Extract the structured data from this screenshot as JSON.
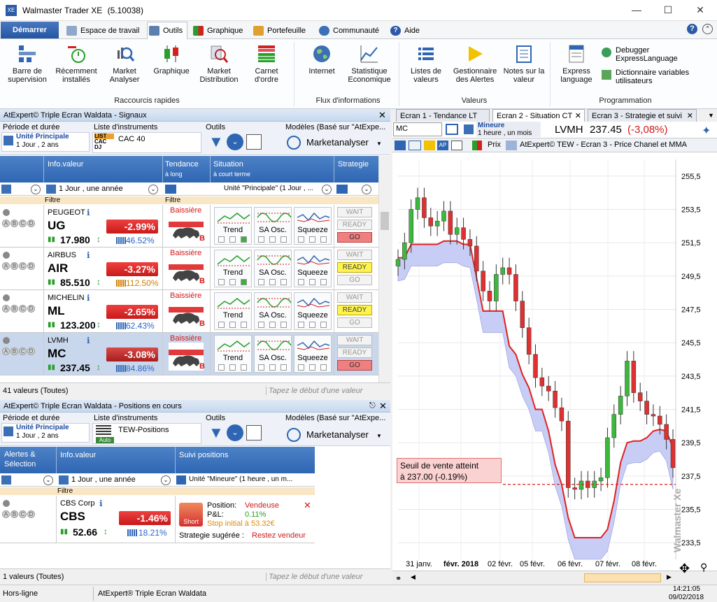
{
  "app": {
    "title": "Walmaster Trader XE",
    "version": "(5.10038)"
  },
  "menu": {
    "start": "Démarrer",
    "items": [
      "Espace de travail",
      "Outils",
      "Graphique",
      "Portefeuille",
      "Communauté",
      "Aide"
    ]
  },
  "ribbon": {
    "groups": [
      {
        "label": "Raccourcis rapides",
        "buttons": [
          "Barre de supervision",
          "Récemment installés",
          "Market Analyser",
          "Graphique",
          "Market Distribution",
          "Carnet d'ordre"
        ]
      },
      {
        "label": "Flux d'informations",
        "buttons": [
          "Internet",
          "Statistique Economique"
        ]
      },
      {
        "label": "Valeurs",
        "buttons": [
          "Listes de valeurs",
          "Gestionnaire des Alertes",
          "Notes sur la valeur"
        ]
      },
      {
        "label": "Programmation",
        "buttons": [
          "Express language"
        ],
        "small": [
          "Debugger ExpressLanguage",
          "Dictionnaire variables utilisateurs"
        ]
      }
    ],
    "b": {
      "b1a": "Barre de",
      "b1b": "supervision",
      "b2a": "Récemment",
      "b2b": "installés",
      "b3a": "Market",
      "b3b": "Analyser",
      "b4": "Graphique",
      "b5a": "Market",
      "b5b": "Distribution",
      "b6a": "Carnet",
      "b6b": "d'ordre",
      "b7": "Internet",
      "b8a": "Statistique",
      "b8b": "Economique",
      "b9a": "Listes de",
      "b9b": "valeurs",
      "b10a": "Gestionnaire",
      "b10b": "des Alertes",
      "b11a": "Notes sur la",
      "b11b": "valeur",
      "b12a": "Express",
      "b12b": "language",
      "s1a": "Debugger",
      "s1b": "ExpressLanguage",
      "s2a": "Dictionnaire variables",
      "s2b": "utilisateurs"
    }
  },
  "p1": {
    "title": "AtExpert© Triple Ecran Waldata - Signaux",
    "h_periode": "Période et durée",
    "unite": "Unité Principale",
    "duree": "1 Jour , 2 ans",
    "h_liste": "Liste d'instruments",
    "liste": "CAC 40",
    "lista": "LIST",
    "listb": "CAC",
    "listc": "DJ",
    "h_outils": "Outils",
    "h_modeles": "Modèles (Basé sur \"AtExpe...",
    "modele": "Marketanalyser",
    "c_info": "Info.valeur",
    "c_tend": "Tendance",
    "c_tend2": "à long",
    "c_sit": "Situation",
    "c_sit2": "à court terme",
    "c_strat": "Strategie",
    "f1": "1 Jour , une année",
    "f2": "Unité \"Principale\" (1 Jour , ...",
    "filtre": "Filtre",
    "footer": "41 valeurs (Toutes)",
    "search": "Tapez le début d'une valeur",
    "rows": [
      {
        "name": "PEUGEOT",
        "code": "UG",
        "price": "17.980",
        "pct": "-2.99%",
        "vol": "46.52%",
        "tend": "Baissière",
        "s1": "WAIT",
        "s2": "READY",
        "s3": "GO"
      },
      {
        "name": "AIRBUS",
        "code": "AIR",
        "price": "85.510",
        "pct": "-3.27%",
        "vol": "112.50%",
        "tend": "Baissière",
        "s1": "WAIT",
        "s2": "READY",
        "s3": "GO"
      },
      {
        "name": "MICHELIN",
        "code": "ML",
        "price": "123.200",
        "pct": "-2.65%",
        "vol": "62.43%",
        "tend": "Baissière",
        "s1": "WAIT",
        "s2": "READY",
        "s3": "GO"
      },
      {
        "name": "LVMH",
        "code": "MC",
        "price": "237.45",
        "pct": "-3.08%",
        "vol": "84.86%",
        "tend": "Baissière",
        "s1": "WAIT",
        "s2": "READY",
        "s3": "GO"
      }
    ],
    "ind": [
      "Trend",
      "SA Osc.",
      "Squeeze"
    ],
    "bmark": "B"
  },
  "p2": {
    "title": "AtExpert© Triple Ecran Waldata - Positions en cours",
    "h_periode": "Période et durée",
    "unite": "Unité Principale",
    "duree": "1 Jour , 2 ans",
    "h_liste": "Liste d'instruments",
    "liste": "TEW-Positions",
    "auto": "Auto",
    "h_outils": "Outils",
    "h_modeles": "Modèles (Basé sur \"AtExpe...",
    "modele": "Marketanalyser",
    "c_alert": "Alertes &",
    "c_alert2": "Sélection",
    "c_info": "Info.valeur",
    "c_suivi": "Suivi positions",
    "f1": "1 Jour , une année",
    "f2": "Unité \"Mineure\" (1 heure , un m...",
    "filtre": "Filtre",
    "row": {
      "name": "CBS Corp",
      "code": "CBS",
      "price": "52.66",
      "pct": "-1.46%",
      "vol": "18.21%",
      "pos_l": "Position:",
      "pos_v": "Vendeuse",
      "pnl_l": "P&L:",
      "pnl_v": "0.11%",
      "stop": "Stop initial à 53.32€",
      "strat_l": "Strategie sugérée :",
      "strat_v": "Restez vendeur",
      "short": "Short"
    },
    "footer": "1 valeurs (Toutes)",
    "search": "Tapez le début d'une valeur"
  },
  "chart_panel": {
    "tabs": [
      "Ecran 1 - Tendance LT",
      "Ecran 2 - Situation CT",
      "Ecran 3 - Strategie et suivi"
    ],
    "symbol_input": "MC",
    "unit": "Mineure",
    "unit2": "1 heure , un mois",
    "instrument": "LVMH",
    "last": "237.45",
    "change": "(-3,08%)",
    "toolbar_prix": "Prix",
    "chart_title": "AtExpert© TEW - Ecran 3 - Price Chanel et MMA",
    "alert_l1": "Seuil de vente atteint",
    "alert_l2": "à 237.00 (-0.19%)",
    "watermark": "Walmaster Xe"
  },
  "chart_data": {
    "type": "line",
    "title": "AtExpert© TEW - Ecran 3 - Price Chanel et MMA",
    "yticks": [
      "255,5",
      "253,5",
      "251,5",
      "249,5",
      "247,5",
      "245,5",
      "243,5",
      "241,5",
      "239,5",
      "237,5",
      "235,5",
      "233,5"
    ],
    "ylim": [
      232.5,
      256.5
    ],
    "xticks": [
      "31 janv.",
      "févr. 2018",
      "02 févr.",
      "05 févr.",
      "06 févr.",
      "07 févr.",
      "08 févr."
    ],
    "threshold": 237.0,
    "series": [
      {
        "name": "",
        "values": [
          250.5,
          251.5,
          253.5,
          254.2,
          253.0,
          252.5,
          252.8,
          253.4,
          252.0,
          252.4,
          251.7,
          251.3,
          249.8,
          248.6,
          248.0,
          249.6,
          250.0,
          249.6,
          248.0,
          246.4,
          244.8,
          243.4,
          242.9,
          242.6,
          241.6,
          240.8,
          236.8,
          236.7,
          237.2,
          236.8,
          237.2,
          237.4,
          239.8,
          241.2,
          242.3,
          244.4,
          242.5,
          242.0,
          241.2,
          241.1,
          240.6,
          239.7,
          238.0
        ]
      }
    ],
    "channel": [
      250.6,
      250.6,
      251.4,
      251.4,
      251.4,
      251.4,
      251.4,
      251.6,
      251.6,
      251.6,
      251.4,
      251.4,
      249.4,
      247.4,
      247.4,
      247.4,
      247.4,
      245.3,
      244.8,
      243.6,
      242.8,
      241.5,
      241.5,
      240.2,
      238.2,
      237.0,
      235.0,
      233.8,
      233.8,
      233.8,
      233.8,
      233.8,
      234.3,
      236.0,
      238.3,
      239.5,
      239.6,
      239.6,
      239.8,
      240.2,
      240.3,
      240.2,
      239.2
    ]
  },
  "status": {
    "left": "Hors-ligne",
    "mid": "AtExpert® Triple Ecran Waldata",
    "time": "14:21:05",
    "date": "09/02/2018"
  }
}
